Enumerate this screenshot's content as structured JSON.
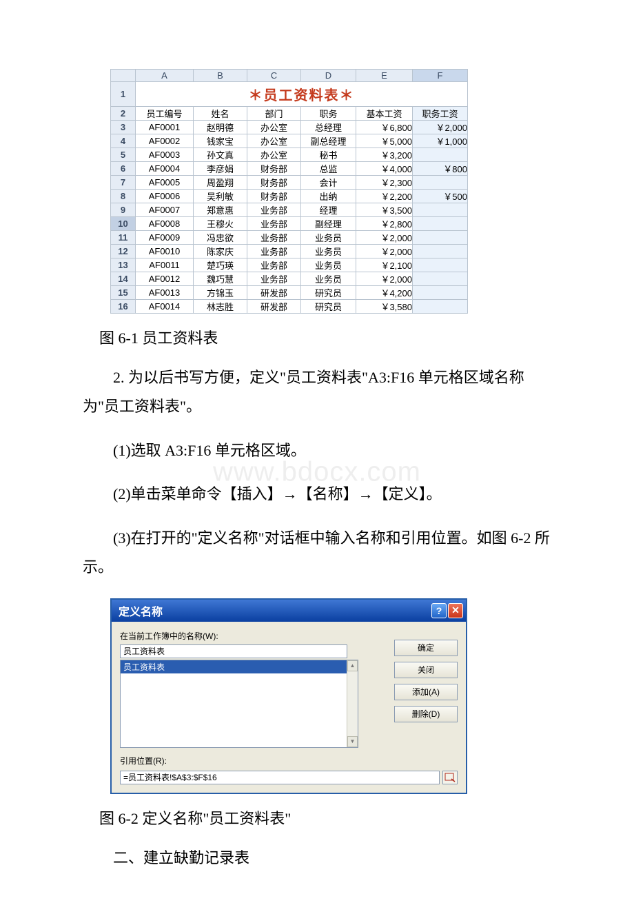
{
  "spreadsheet": {
    "title": "＊员工资料表＊",
    "col_letters": [
      "A",
      "B",
      "C",
      "D",
      "E",
      "F"
    ],
    "headers": [
      "员工编号",
      "姓名",
      "部门",
      "职务",
      "基本工资",
      "职务工资"
    ],
    "rows": [
      {
        "n": "1"
      },
      {
        "n": "2"
      },
      {
        "n": "3",
        "id": "AF0001",
        "name": "赵明德",
        "dept": "办公室",
        "title": "总经理",
        "base": "￥6,800",
        "duty": "￥2,000"
      },
      {
        "n": "4",
        "id": "AF0002",
        "name": "钱家宝",
        "dept": "办公室",
        "title": "副总经理",
        "base": "￥5,000",
        "duty": "￥1,000"
      },
      {
        "n": "5",
        "id": "AF0003",
        "name": "孙文真",
        "dept": "办公室",
        "title": "秘书",
        "base": "￥3,200",
        "duty": ""
      },
      {
        "n": "6",
        "id": "AF0004",
        "name": "李彦娟",
        "dept": "财务部",
        "title": "总监",
        "base": "￥4,000",
        "duty": "￥800"
      },
      {
        "n": "7",
        "id": "AF0005",
        "name": "周盈翔",
        "dept": "财务部",
        "title": "会计",
        "base": "￥2,300",
        "duty": ""
      },
      {
        "n": "8",
        "id": "AF0006",
        "name": "吴利敏",
        "dept": "财务部",
        "title": "出纳",
        "base": "￥2,200",
        "duty": "￥500"
      },
      {
        "n": "9",
        "id": "AF0007",
        "name": "郑意惠",
        "dept": "业务部",
        "title": "经理",
        "base": "￥3,500",
        "duty": ""
      },
      {
        "n": "10",
        "id": "AF0008",
        "name": "王穆火",
        "dept": "业务部",
        "title": "副经理",
        "base": "￥2,800",
        "duty": ""
      },
      {
        "n": "11",
        "id": "AF0009",
        "name": "冯忠欲",
        "dept": "业务部",
        "title": "业务员",
        "base": "￥2,000",
        "duty": ""
      },
      {
        "n": "12",
        "id": "AF0010",
        "name": "陈家庆",
        "dept": "业务部",
        "title": "业务员",
        "base": "￥2,000",
        "duty": ""
      },
      {
        "n": "13",
        "id": "AF0011",
        "name": "楚巧瑛",
        "dept": "业务部",
        "title": "业务员",
        "base": "￥2,100",
        "duty": ""
      },
      {
        "n": "14",
        "id": "AF0012",
        "name": "魏巧慧",
        "dept": "业务部",
        "title": "业务员",
        "base": "￥2,000",
        "duty": ""
      },
      {
        "n": "15",
        "id": "AF0013",
        "name": "方锦玉",
        "dept": "研发部",
        "title": "研究员",
        "base": "￥4,200",
        "duty": ""
      },
      {
        "n": "16",
        "id": "AF0014",
        "name": "林志胜",
        "dept": "研发部",
        "title": "研究员",
        "base": "￥3,580",
        "duty": ""
      }
    ]
  },
  "captions": {
    "fig1": "图 6-1 员工资料表",
    "fig2": "图 6-2 定义名称\"员工资料表\""
  },
  "text": {
    "p1": "2. 为以后书写方便，定义\"员工资料表\"A3:F16 单元格区域名称为\"员工资料表\"。",
    "p2": "(1)选取 A3:F16 单元格区域。",
    "p3": "(2)单击菜单命令【插入】→【名称】→【定义】。",
    "p4": "(3)在打开的\"定义名称\"对话框中输入名称和引用位置。如图 6-2 所示。",
    "section2": "二、建立缺勤记录表"
  },
  "watermark": "www.bdocx.com",
  "dialog": {
    "title": "定义名称",
    "label_names": "在当前工作簿中的名称(W):",
    "input_value": "员工资料表",
    "list_selected": "员工资料表",
    "label_ref": "引用位置(R):",
    "ref_value": "=员工资料表!$A$3:$F$16",
    "buttons": {
      "ok": "确定",
      "close": "关闭",
      "add": "添加(A)",
      "delete": "删除(D)"
    }
  }
}
